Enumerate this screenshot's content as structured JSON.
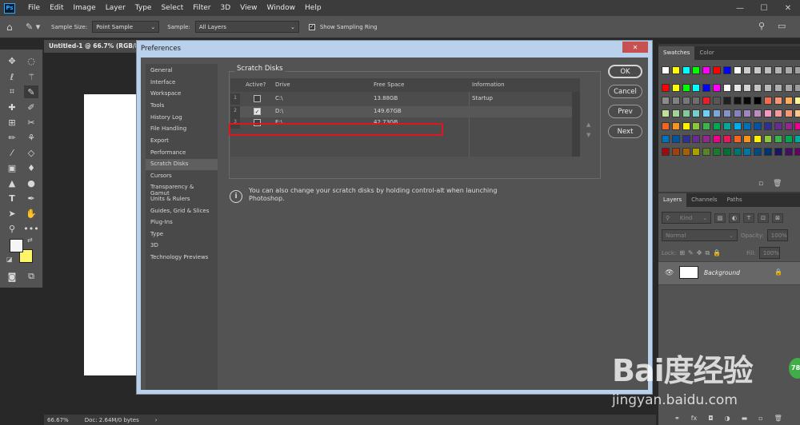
{
  "app": {
    "logo": "Ps"
  },
  "menu": [
    "File",
    "Edit",
    "Image",
    "Layer",
    "Type",
    "Select",
    "Filter",
    "3D",
    "View",
    "Window",
    "Help"
  ],
  "window_controls": {
    "minimize": "—",
    "maximize": "☐",
    "close": "✕"
  },
  "options_bar": {
    "sample_size_label": "Sample Size:",
    "sample_size_value": "Point Sample",
    "sample_label": "Sample:",
    "sample_value": "All Layers",
    "show_ring_label": "Show Sampling Ring"
  },
  "document": {
    "tab_title": "Untitled-1 @ 66.7% (RGB/8#)",
    "zoom": "66.67%",
    "doc_info": "Doc: 2.64M/0 bytes"
  },
  "dialog": {
    "title": "Preferences",
    "close": "✕",
    "categories": [
      "General",
      "Interface",
      "Workspace",
      "Tools",
      "History Log",
      "File Handling",
      "Export",
      "Performance",
      "Scratch Disks",
      "Cursors",
      "Transparency & Gamut",
      "Units & Rulers",
      "Guides, Grid & Slices",
      "Plug-Ins",
      "Type",
      "3D",
      "Technology Previews"
    ],
    "selected_category": "Scratch Disks",
    "section_title": "Scratch Disks",
    "table_headers": {
      "active": "Active?",
      "drive": "Drive",
      "free": "Free Space",
      "info": "Information"
    },
    "rows": [
      {
        "num": "1",
        "active": false,
        "drive": "C:\\",
        "free": "13.88GB",
        "info": "Startup"
      },
      {
        "num": "2",
        "active": true,
        "drive": "D:\\",
        "free": "149.67GB",
        "info": ""
      },
      {
        "num": "3",
        "active": false,
        "drive": "E:\\",
        "free": "42.73GB",
        "info": ""
      }
    ],
    "info_text": "You can also change your scratch disks by holding control-alt when launching Photoshop.",
    "buttons": {
      "ok": "OK",
      "cancel": "Cancel",
      "prev": "Prev",
      "next": "Next"
    },
    "arrows": {
      "up": "▲",
      "down": "▼"
    }
  },
  "swatches_panel": {
    "tabs": [
      "Swatches",
      "Color"
    ],
    "colors": [
      "#ffffff",
      "#ffff00",
      "#00ffff",
      "#00ff00",
      "#ff00ff",
      "#ff0000",
      "#0000ff",
      "#ffffff",
      "#cccccc",
      "#c8c8c8",
      "#bebebe",
      "#b4b4b4",
      "#aaaaaa",
      "#a0a0a0",
      "#ff0000",
      "#ffff00",
      "#00ff00",
      "#00ffff",
      "#0000ff",
      "#ff00ff",
      "#ffffff",
      "#e6e6e6",
      "#d2d2d2",
      "#c3c3c3",
      "#b9b9b9",
      "#afafaf",
      "#a5a5a5",
      "#9b9b9b",
      "#8c8c8c",
      "#828282",
      "#787878",
      "#6e6e6e",
      "#ee1c24",
      "#585858",
      "#202020",
      "#141414",
      "#0a0a0a",
      "#000000",
      "#f26c4f",
      "#f69679",
      "#fbaf5d",
      "#fff799",
      "#c4df9b",
      "#a3d39c",
      "#82ca9c",
      "#7accc8",
      "#6dcff6",
      "#7da7d9",
      "#8393ca",
      "#8781bd",
      "#a186be",
      "#bd8cbf",
      "#f49ac1",
      "#f5989d",
      "#f7977a",
      "#fdc68a",
      "#f26522",
      "#f7941d",
      "#fff200",
      "#8dc63f",
      "#39b54a",
      "#00a651",
      "#00a99d",
      "#00aeef",
      "#0072bc",
      "#0054a6",
      "#2e3192",
      "#662d91",
      "#92278f",
      "#ec008c",
      "#0072bc",
      "#0054a6",
      "#2e3192",
      "#662d91",
      "#92278f",
      "#ec008c",
      "#ed145b",
      "#f26522",
      "#f7941d",
      "#fff200",
      "#8dc63f",
      "#39b54a",
      "#00a651",
      "#00a99d",
      "#9e0b0f",
      "#a0410d",
      "#a36209",
      "#aba000",
      "#598527",
      "#1a7b30",
      "#007236",
      "#00746b",
      "#0076a3",
      "#004a80",
      "#003471",
      "#1b1464",
      "#440e62",
      "#630460"
    ]
  },
  "layers_panel": {
    "tabs": [
      "Layers",
      "Channels",
      "Paths"
    ],
    "kind_label": "Kind",
    "blend_mode": "Normal",
    "opacity_label": "Opacity:",
    "opacity_value": "100%",
    "lock_label": "Lock:",
    "fill_label": "Fill:",
    "fill_value": "100%",
    "layer_name": "Background"
  },
  "watermark": {
    "logo": "Bai度经验",
    "url": "jingyan.baidu.com"
  },
  "badge": "78"
}
